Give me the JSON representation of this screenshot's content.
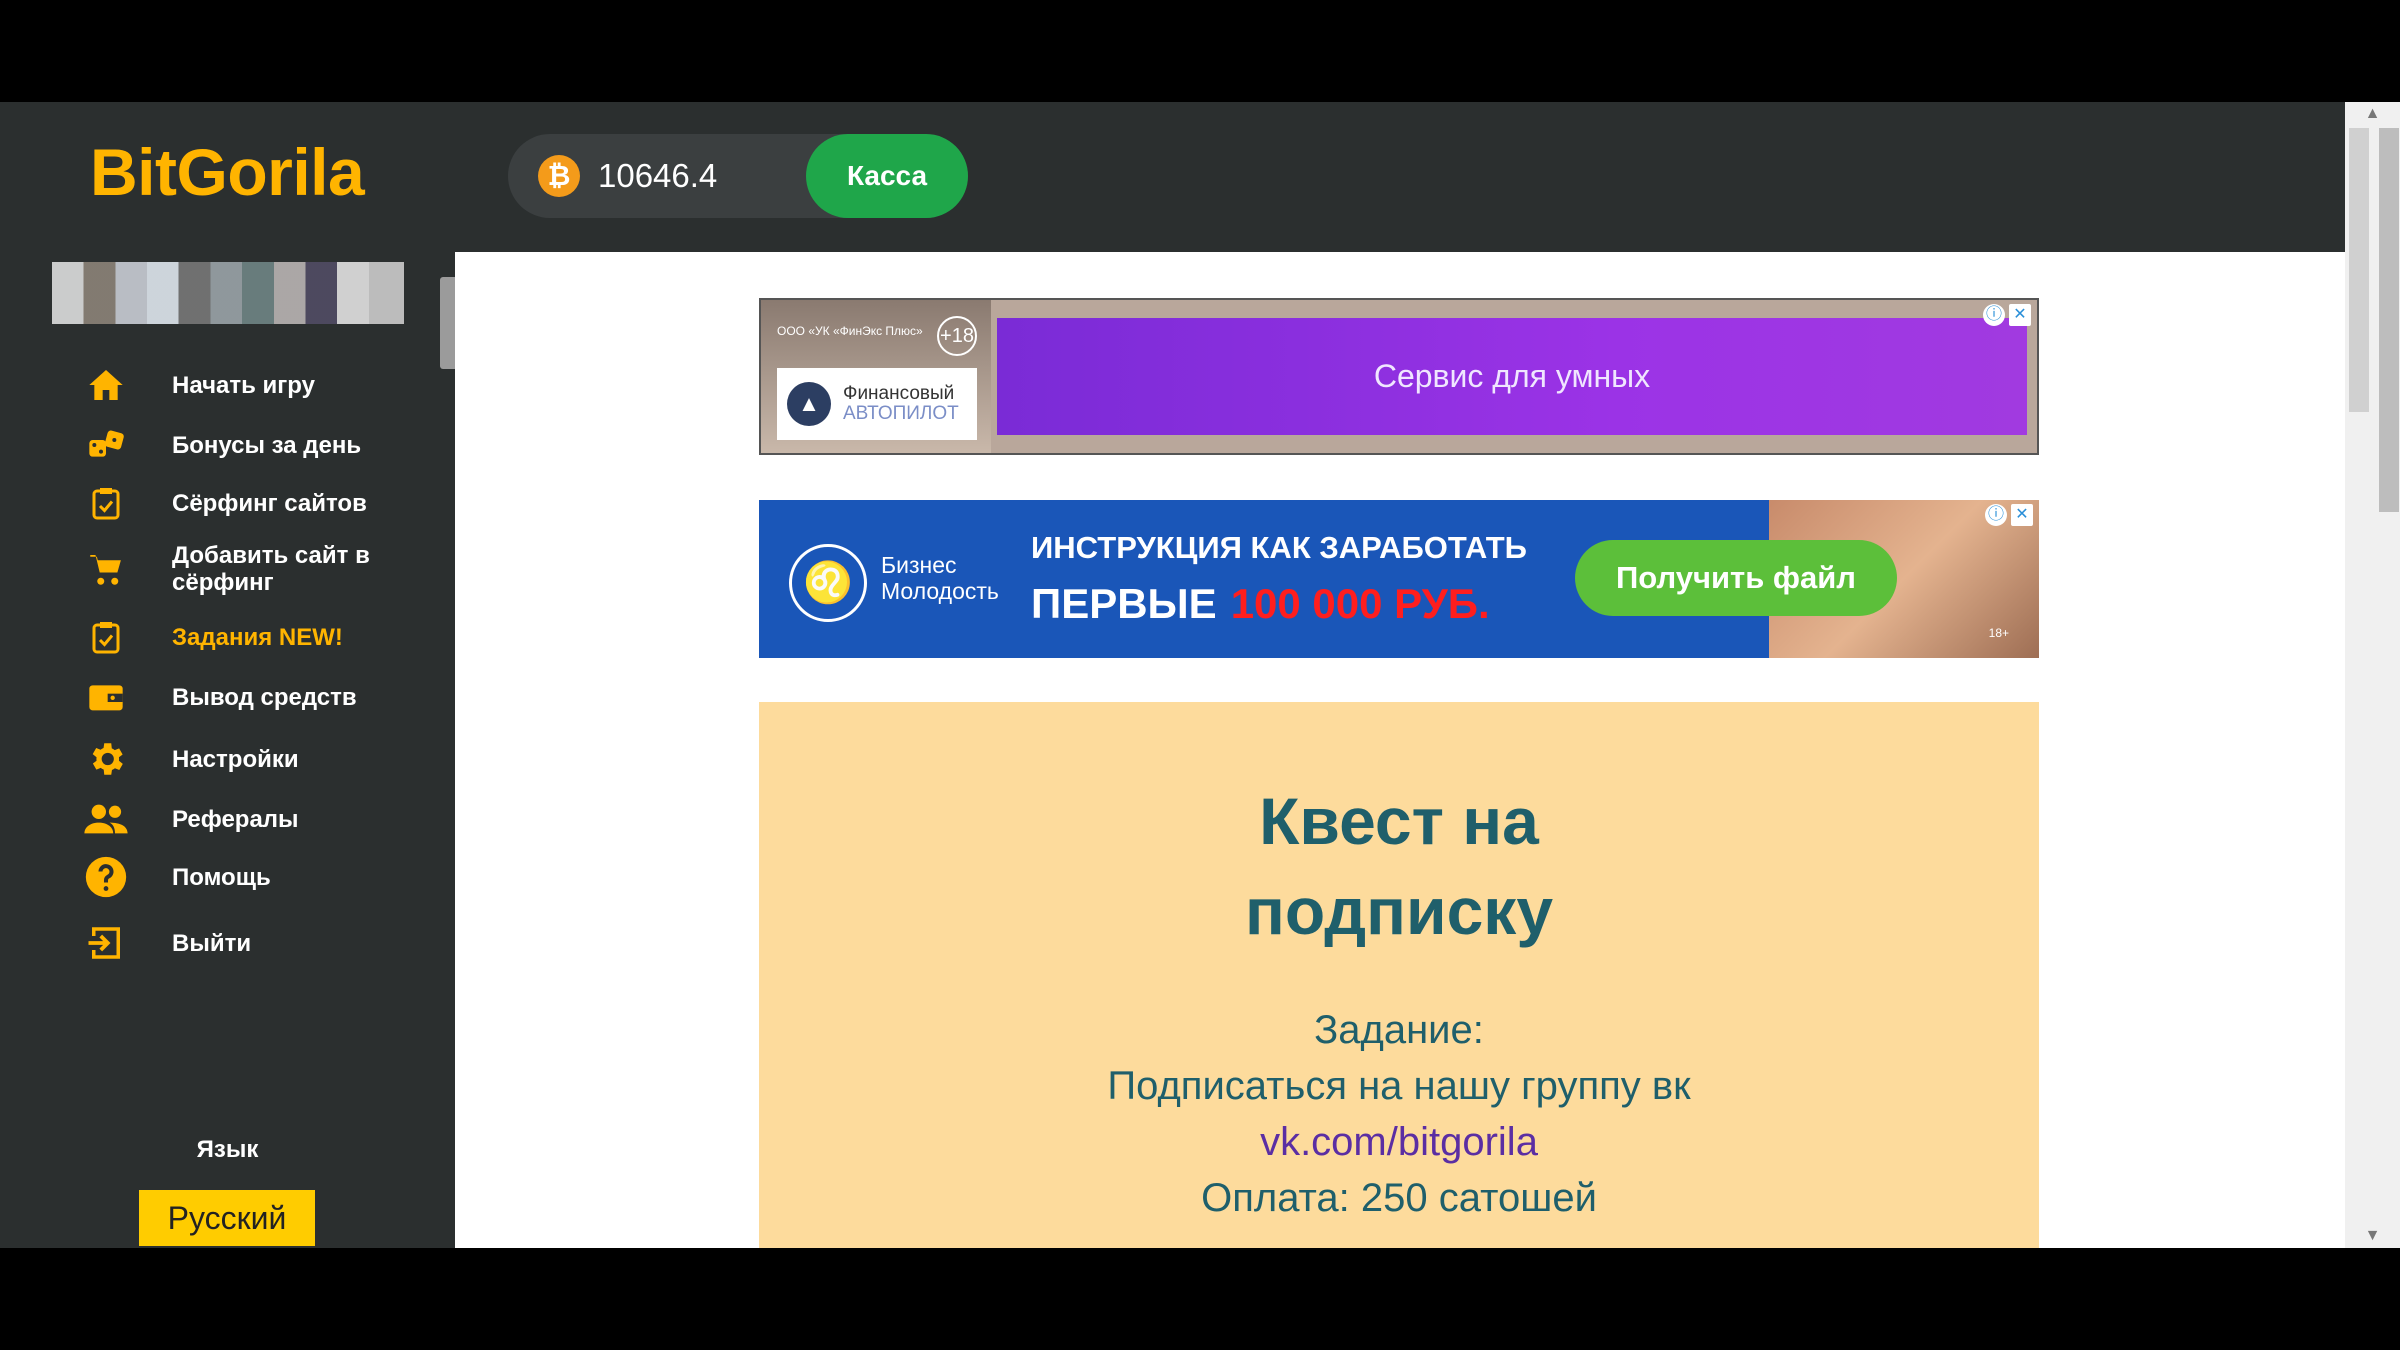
{
  "header": {
    "logo": "BitGorila",
    "balance": "10646.4",
    "coin_symbol": "₿",
    "kassa_label": "Касса"
  },
  "sidebar": {
    "items": [
      {
        "label": "Начать игру",
        "icon": "home-icon"
      },
      {
        "label": "Бонусы за день",
        "icon": "dice-icon"
      },
      {
        "label": "Сёрфинг сайтов",
        "icon": "clipboard-icon"
      },
      {
        "label": "Добавить сайт в сёрфинг",
        "icon": "cart-icon"
      },
      {
        "label": "Задания NEW!",
        "icon": "clipboard-check-icon"
      },
      {
        "label": "Вывод средств",
        "icon": "wallet-icon"
      },
      {
        "label": "Настройки",
        "icon": "gear-icon"
      },
      {
        "label": "Рефералы",
        "icon": "users-icon"
      },
      {
        "label": "Помощь",
        "icon": "help-icon"
      },
      {
        "label": "Выйти",
        "icon": "logout-icon"
      }
    ],
    "language_title": "Язык",
    "language_value": "Русский"
  },
  "ads": {
    "ad1": {
      "company": "ООО «УК «ФинЭкс Плюс»",
      "age": "+18",
      "logo_line1": "Финансовый",
      "logo_line2": "АВТОПИЛОТ",
      "text": "Сервис для умных"
    },
    "ad2": {
      "brand_line1": "Бизнес",
      "brand_line2": "Молодость",
      "line1": "ИНСТРУКЦИЯ КАК ЗАРАБОТАТЬ",
      "line2_white": "ПЕРВЫЕ",
      "line2_red": "100 000 РУБ.",
      "cta": "Получить файл",
      "age": "18+"
    }
  },
  "quest": {
    "title_line1": "Квест на",
    "title_line2": "подписку",
    "task_label": "Задание:",
    "task_text": "Подписаться на нашу группу вк",
    "link": "vk.com/bitgorila",
    "payment": "Оплата: 250 сатошей"
  },
  "colors": {
    "accent": "#ffb400",
    "sidebar_bg": "#2b2f2f",
    "kassa_green": "#1fa64a",
    "quest_bg": "#fddb9c",
    "quest_text": "#1f5f6b"
  }
}
